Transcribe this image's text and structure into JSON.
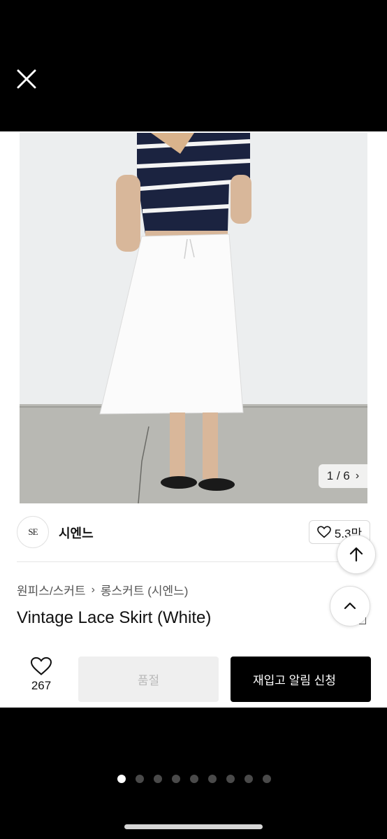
{
  "viewer": {
    "close_label": "close"
  },
  "gallery": {
    "counter": "1 / 6",
    "current": 1,
    "total": 6
  },
  "store": {
    "logo_text": "SE",
    "name": "시엔느",
    "likes": "5.3만"
  },
  "product": {
    "breadcrumb": [
      "원피스/스커트",
      "롱스커트 (시엔느)"
    ],
    "title": "Vintage Lace Skirt (White)"
  },
  "actions": {
    "wish_count": "267",
    "soldout_label": "품절",
    "restock_label": "재입고 알림 신청"
  },
  "pager": {
    "total": 9,
    "active_index": 0
  },
  "colors": {
    "background": "#000000",
    "card": "#ffffff",
    "primary_button": "#000000",
    "disabled_button": "#efefef"
  }
}
